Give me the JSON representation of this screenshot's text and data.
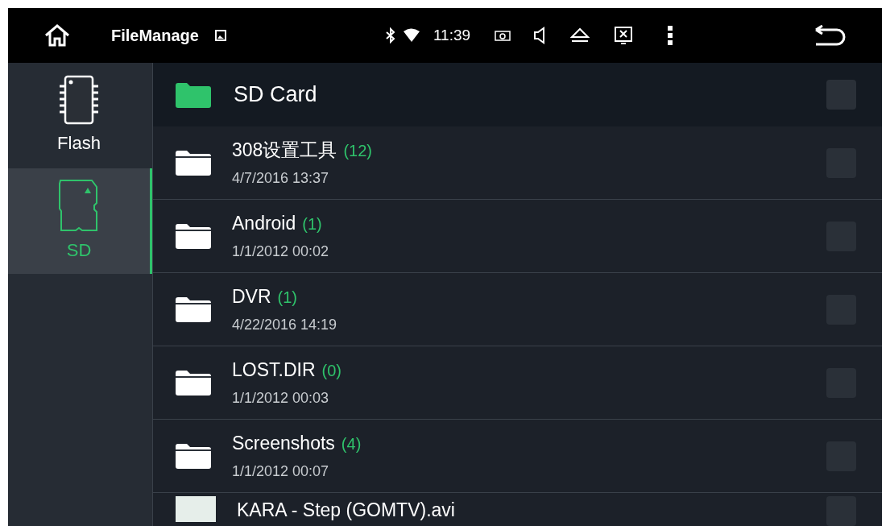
{
  "status_bar": {
    "app_title": "FileManage",
    "time": "11:39"
  },
  "sidebar": {
    "items": [
      {
        "label": "Flash",
        "kind": "flash",
        "selected": false
      },
      {
        "label": "SD",
        "kind": "sd",
        "selected": true
      }
    ]
  },
  "location": {
    "label": "SD Card",
    "checked": false
  },
  "files": [
    {
      "kind": "folder",
      "name": "308设置工具",
      "count": "(12)",
      "date": "4/7/2016 13:37",
      "checked": false
    },
    {
      "kind": "folder",
      "name": "Android",
      "count": "(1)",
      "date": "1/1/2012 00:02",
      "checked": false
    },
    {
      "kind": "folder",
      "name": "DVR",
      "count": "(1)",
      "date": "4/22/2016 14:19",
      "checked": false
    },
    {
      "kind": "folder",
      "name": "LOST.DIR",
      "count": "(0)",
      "date": "1/1/2012 00:03",
      "checked": false
    },
    {
      "kind": "folder",
      "name": "Screenshots",
      "count": "(4)",
      "date": "1/1/2012 00:07",
      "checked": false
    },
    {
      "kind": "video",
      "name": "KARA - Step (GOMTV).avi",
      "checked": false
    }
  ]
}
